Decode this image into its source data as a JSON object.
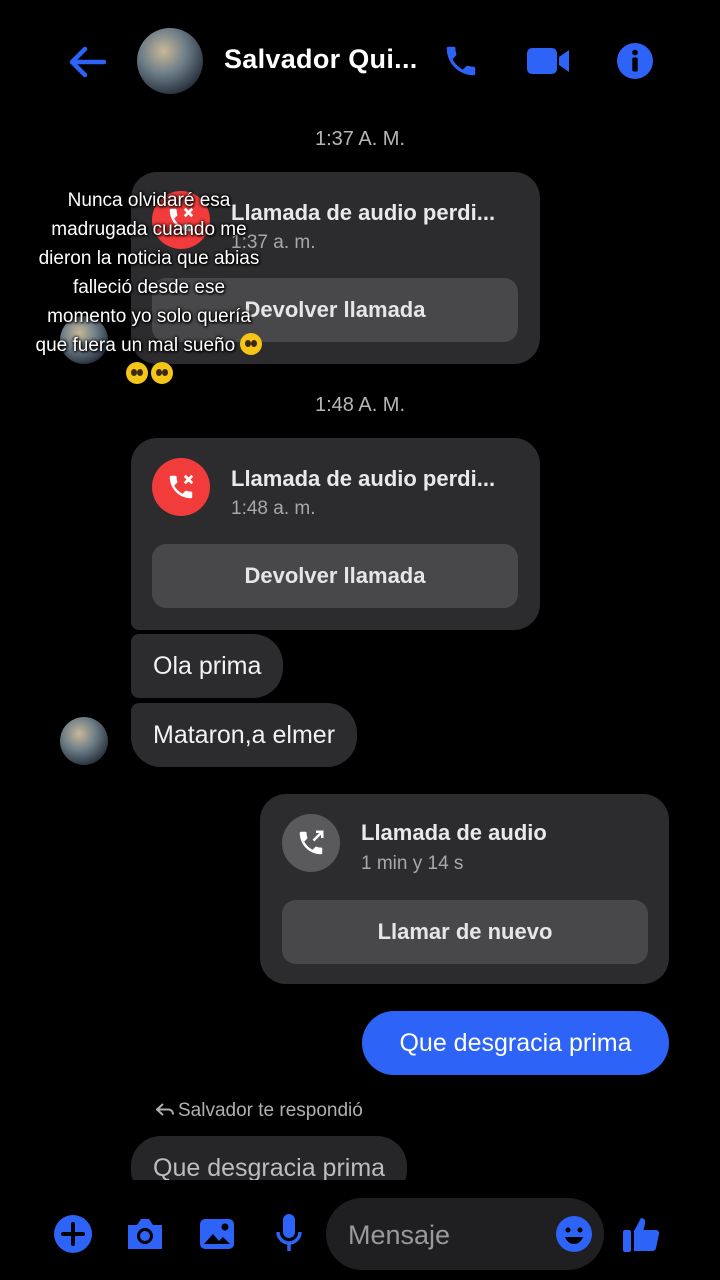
{
  "header": {
    "contact_name": "Salvador Qui...",
    "icons": [
      "back-arrow-icon",
      "phone-icon",
      "video-camera-icon",
      "info-icon"
    ],
    "accent_color": "#2d63f6"
  },
  "overlay_caption": {
    "lines": [
      "Nunca olvidaré esa",
      "madrugada cuando me",
      "dieron la noticia que abias",
      "falleció desde ese",
      "momento yo solo quería",
      "que fuera un mal sueño"
    ],
    "emoji": "pleading-face"
  },
  "conversation": {
    "timestamp_1": "1:37 A. M.",
    "missed_call_1": {
      "title": "Llamada de audio perdi...",
      "time": "1:37 a. m.",
      "button": "Devolver llamada"
    },
    "timestamp_2": "1:48 A. M.",
    "missed_call_2": {
      "title": "Llamada de audio perdi...",
      "time": "1:48 a. m.",
      "button": "Devolver llamada"
    },
    "incoming_1": "Ola prima",
    "incoming_2": "Mataron,a elmer",
    "outgoing_call": {
      "title": "Llamada de audio",
      "duration": "1 min y 14 s",
      "button": "Llamar de nuevo"
    },
    "outgoing_1": "Que desgracia prima",
    "reply_notice": "Salvador te respondió",
    "reply_quote": "Que desgracia prima"
  },
  "composer": {
    "placeholder": "Mensaje",
    "icons": [
      "plus-icon",
      "camera-icon",
      "image-icon",
      "microphone-icon",
      "emoji-icon",
      "thumbs-up-icon"
    ]
  },
  "colors": {
    "missed_call_red": "#f23b3b",
    "bubble_gray": "#2c2c2e",
    "button_gray": "#48484a"
  }
}
